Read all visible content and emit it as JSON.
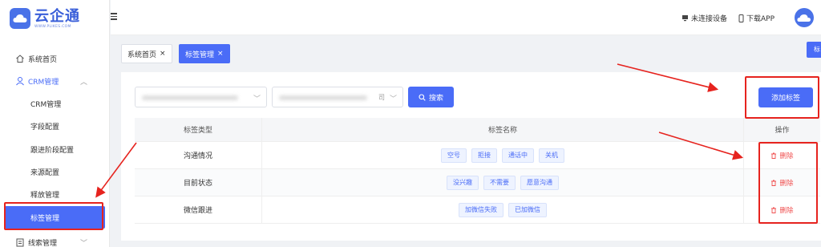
{
  "app": {
    "logo_name": "云企通",
    "logo_sub": "WWW.PLIKES.COM"
  },
  "header": {
    "device_status": "未连接设备",
    "download_app": "下载APP"
  },
  "sidebar": {
    "items": [
      {
        "label": "系统首页",
        "icon": "home-icon"
      },
      {
        "label": "CRM管理",
        "icon": "user-icon",
        "expanded": true
      },
      {
        "label": "CRM管理"
      },
      {
        "label": "字段配置"
      },
      {
        "label": "跟进阶段配置"
      },
      {
        "label": "来源配置"
      },
      {
        "label": "释放管理"
      },
      {
        "label": "标签管理",
        "active": true
      },
      {
        "label": "线索管理",
        "icon": "clipboard-icon"
      }
    ]
  },
  "tabs": [
    {
      "label": "系统首页",
      "close": "×"
    },
    {
      "label": "标签管理",
      "close": "×",
      "active": true
    }
  ],
  "corner_button": {
    "label": "标"
  },
  "filters": {
    "select2_suffix": "司",
    "search_label": "搜索",
    "add_label": "添加标签"
  },
  "table": {
    "headers": [
      "标签类型",
      "标签名称",
      "操作"
    ],
    "rows": [
      {
        "type": "沟通情况",
        "tags": [
          "空号",
          "拒接",
          "通话中",
          "关机"
        ],
        "action": "删除"
      },
      {
        "type": "目前状态",
        "tags": [
          "没兴趣",
          "不需要",
          "愿意沟通"
        ],
        "action": "删除"
      },
      {
        "type": "微信跟进",
        "tags": [
          "加微信失败",
          "已加微信"
        ],
        "action": "删除"
      }
    ]
  },
  "colors": {
    "accent": "#4a6cf7",
    "danger": "#f05050",
    "annotation": "#e6231e"
  }
}
